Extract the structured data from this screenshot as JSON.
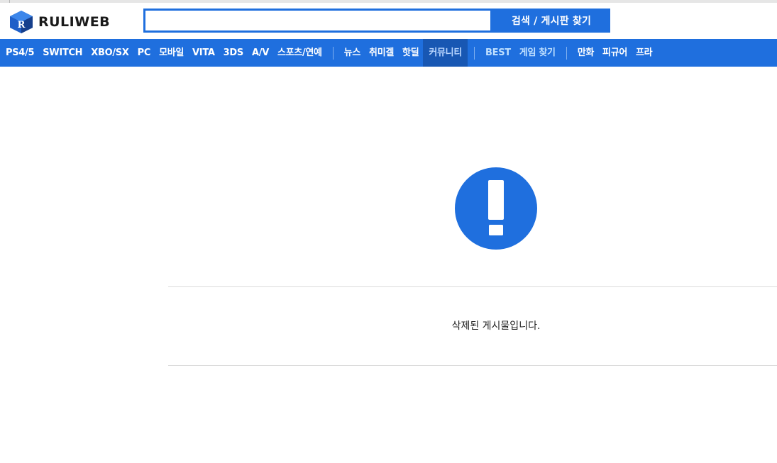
{
  "header": {
    "logo_text": "RULIWEB",
    "search": {
      "value": "",
      "placeholder": ""
    },
    "search_button_label": "검색 / 게시판 찾기"
  },
  "nav": {
    "group1": [
      "PS4/5",
      "SWITCH",
      "XBO/SX",
      "PC",
      "모바일",
      "VITA",
      "3DS",
      "A/V",
      "스포츠/연예"
    ],
    "group2": [
      "뉴스",
      "취미겔",
      "핫딜"
    ],
    "active": "커뮤니티",
    "best": "BEST",
    "game_find": "게임 찾기",
    "group3": [
      "만화",
      "피규어",
      "프라"
    ]
  },
  "content": {
    "icon": "exclamation-circle-icon",
    "message": "삭제된 게시물입니다."
  },
  "colors": {
    "accent": "#1f6fde",
    "active_tab": "#1857b3",
    "alert": "#1f6fde"
  }
}
